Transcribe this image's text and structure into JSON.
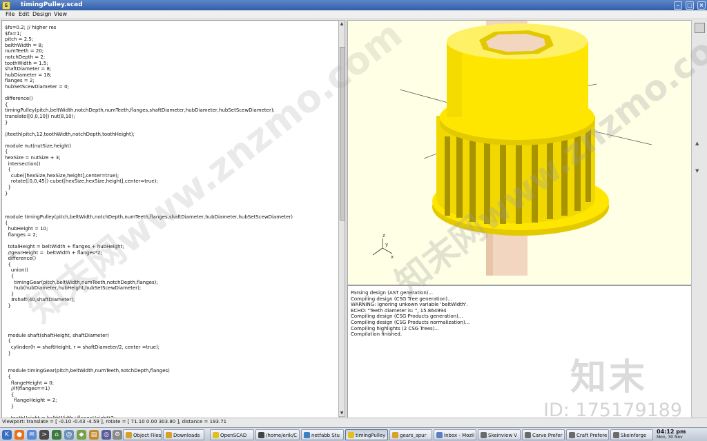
{
  "window": {
    "title": "timingPulley.scad",
    "app_icon": "openscad-icon",
    "controls": [
      "minimize",
      "maximize",
      "close"
    ]
  },
  "menu": [
    "File",
    "Edit",
    "Design",
    "View"
  ],
  "editor": {
    "code": "$fs=0.2; // higher res\n$fa=1;\npitch = 2.5;\nbelthWidth = 8;\nnumTeeth = 20;\nnotchDepth = 2;\ntoothWidth = 1.5;\nshaftDiameter = 8;\nhubDiameter = 18;\nflanges = 2;\nhubSetScewDiameter = 0;\n\ndifference()\n{\ntimingPulley(pitch,beltWidth,notchDepth,numTeeth,flanges,shaftDiameter,hubDiameter,hubSetScewDiameter);\ntranslate([0,0,10]) nut(8,10);\n}\n\n//teeth(pitch,12,toothWidth,notchDepth,toothHeight);\n\nmodule nut(nutSize,height)\n{\nhexSize = nutSize + 3;\n\tintersection()\n\t{\n\t\tcube([hexSize,hexSize,height],center=true);\n\t\trotate([0,0,45]) cube([hexSize,hexSize,height],center=true);\n\t}\n}\n\n\n\nmodule timingPulley(pitch,beltWidth,notchDepth,numTeeth,flanges,shaftDiameter,hubDiameter,hubSetScewDiameter)\n{\n\thubHeight = 10;\n\tflanges = 2;\n\n\ttotalHeight = beltWidth + flanges + hubHeight;\n\t//gearHeight =  beltWidth + flanges*2;\n\tdifference()\n\t{\n\t\tunion()\n\t\t{\n\t\t\ttimingGear(pitch,beltWidth,numTeeth,notchDepth,flanges);\n\t\t\thub(hubDiameter,hubHeight,hubSetScewDiameter);\n\t\t}\n\t\t#shaft(40,shaftDiameter);\n\t}\n\n\n\n\n\tmodule shaft(shaftHeight, shaftDiameter)\n\t{\n\t\tcylinder(h = shaftHeight, r = shaftDiameter/2, center =true);\n\t}\n\n\n\tmodule timingGear(pitch,beltWidth,numTeeth,notchDepth,flanges)\n\t{\n\t\tflangeHeight = 0;\n\t\t//if(flanges==1)\n\t\t{\n\t\t\tflangeHeight = 2;\n\t\t}\n\n\t\ttoothHeight = belthWidth+flangeHeight*2;"
  },
  "console": {
    "lines": [
      "Parsing design (AST generation)...",
      "Compiling design (CSG Tree generation)...",
      "WARNING: Ignoring unkown variable 'beltWidth'.",
      "ECHO: \"Teeth diameter is: \", 15.864994",
      "Compiling design (CSG Products generation)...",
      "Compiling design (CSG Products normalization)...",
      "Compiling highlights (2 CSG Trees)...",
      "Compilation finished."
    ]
  },
  "viewport": {
    "axis_labels": [
      "z",
      "y",
      "x"
    ],
    "colors": {
      "background": "#ffffe5",
      "model": "#ffe600",
      "model_dark": "#b59f00",
      "shaft": "#f2d6bf"
    }
  },
  "statusbar": {
    "text": "Viewport: translate = [ -0.10 -0.43 -4.59 ], rotate = [ 71.10 0.00 303.80 ], distance = 193.71"
  },
  "taskbar": {
    "launchers": [
      "kde-menu-icon",
      "firefox-icon",
      "kontact-icon",
      "terminal-icon",
      "home-icon",
      "kmail-icon"
    ],
    "tasks": [
      {
        "label": "Object Files",
        "active": false
      },
      {
        "label": "Downloads",
        "active": false
      },
      {
        "label": "OpenSCAD",
        "active": false
      },
      {
        "label": "/home/erik/C",
        "active": false
      },
      {
        "label": "netfabb Stu",
        "active": false
      },
      {
        "label": "timingPulley",
        "active": true
      },
      {
        "label": "gears_spur",
        "active": false
      },
      {
        "label": "Inbox - Mozil",
        "active": false
      },
      {
        "label": "Skeinview V",
        "active": false
      },
      {
        "label": "Carve Prefer",
        "active": false
      },
      {
        "label": "Craft Prefere",
        "active": false
      },
      {
        "label": "Skeinforge",
        "active": false
      }
    ],
    "clock_time": "04:12 pm",
    "clock_date": "Mon, 30 Nov"
  },
  "watermark": {
    "logo": "知末",
    "id": "ID: 175179189",
    "diagonal": "知末网www.znzmo.com"
  }
}
